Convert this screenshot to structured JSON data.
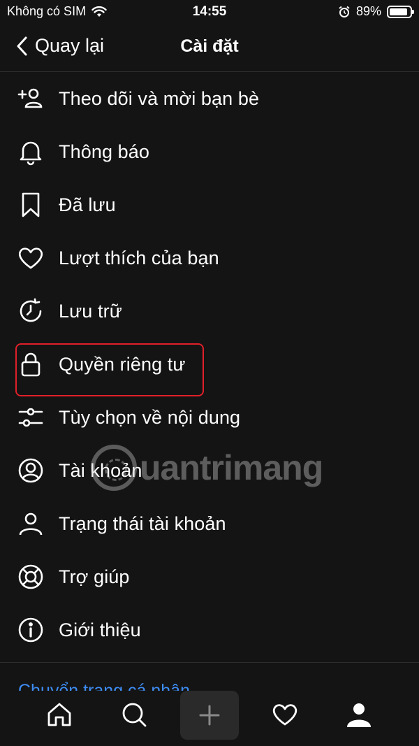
{
  "status_bar": {
    "carrier": "Không có SIM",
    "time": "14:55",
    "battery": "89%",
    "battery_level": 0.89
  },
  "header": {
    "back_label": "Quay lại",
    "title": "Cài đặt"
  },
  "menu": {
    "items": [
      {
        "label": "Theo dõi và mời bạn bè",
        "icon": "add-person-icon"
      },
      {
        "label": "Thông báo",
        "icon": "bell-icon"
      },
      {
        "label": "Đã lưu",
        "icon": "bookmark-icon"
      },
      {
        "label": "Lượt thích của bạn",
        "icon": "heart-icon"
      },
      {
        "label": "Lưu trữ",
        "icon": "archive-clock-icon"
      },
      {
        "label": "Quyền riêng tư",
        "icon": "lock-icon"
      },
      {
        "label": "Tùy chọn về nội dung",
        "icon": "sliders-icon"
      },
      {
        "label": "Tài khoản",
        "icon": "account-circle-icon"
      },
      {
        "label": "Trạng thái tài khoản",
        "icon": "person-icon"
      },
      {
        "label": "Trợ giúp",
        "icon": "lifebuoy-icon"
      },
      {
        "label": "Giới thiệu",
        "icon": "info-icon"
      }
    ],
    "highlighted": "Quyền riêng tư",
    "highlight_color": "#e0202a"
  },
  "switch_profile_label": "Chuyển trang cá nhân",
  "watermark": "uantrimang",
  "tabbar": {
    "tabs": [
      "home-icon",
      "search-icon",
      "plus-icon",
      "heart-icon",
      "profile-icon"
    ]
  },
  "colors": {
    "background": "#141414",
    "link": "#3e8df5"
  }
}
